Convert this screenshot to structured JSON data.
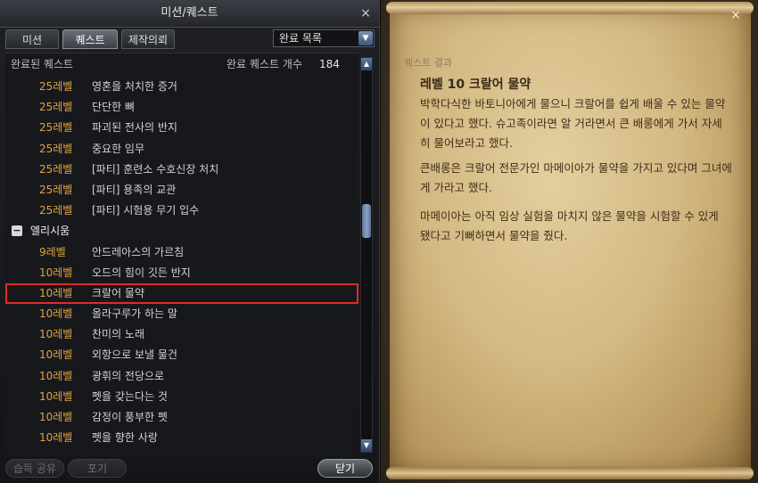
{
  "window": {
    "title": "미션/퀘스트",
    "close_glyph": "×"
  },
  "tabs": [
    {
      "label": "미션",
      "active": false
    },
    {
      "label": "퀘스트",
      "active": true
    },
    {
      "label": "제작의뢰",
      "active": false
    }
  ],
  "filter": {
    "selected": "완료 목록",
    "arrow_glyph": "▼"
  },
  "list_header": {
    "left": "완료된 퀘스트",
    "count_label": "완료 퀘스트 개수",
    "count": "184"
  },
  "rows": [
    {
      "type": "quest",
      "level": "25레벨",
      "name": "영혼을 처치한 증거"
    },
    {
      "type": "quest",
      "level": "25레벨",
      "name": "단단한 뼈"
    },
    {
      "type": "quest",
      "level": "25레벨",
      "name": "파괴된 전사의 반지"
    },
    {
      "type": "quest",
      "level": "25레벨",
      "name": "중요한 임무"
    },
    {
      "type": "quest",
      "level": "25레벨",
      "name": "[파티] 훈련소 수호신장 처치"
    },
    {
      "type": "quest",
      "level": "25레벨",
      "name": "[파티] 용족의 교관"
    },
    {
      "type": "quest",
      "level": "25레벨",
      "name": "[파티] 시험용 무기 입수"
    },
    {
      "type": "group",
      "toggle": "−",
      "name": "엘리시움"
    },
    {
      "type": "quest",
      "level": "9레벨",
      "name": "안드레아스의 가르침"
    },
    {
      "type": "quest",
      "level": "10레벨",
      "name": "오드의 힘이 깃든 반지"
    },
    {
      "type": "quest",
      "level": "10레벨",
      "name": "크랄어 물약",
      "selected": true
    },
    {
      "type": "quest",
      "level": "10레벨",
      "name": "올라구루가 하는 말"
    },
    {
      "type": "quest",
      "level": "10레벨",
      "name": "찬미의 노래"
    },
    {
      "type": "quest",
      "level": "10레벨",
      "name": "외항으로 보낼 물건"
    },
    {
      "type": "quest",
      "level": "10레벨",
      "name": "광휘의 전당으로"
    },
    {
      "type": "quest",
      "level": "10레벨",
      "name": "펫을 갖는다는 것"
    },
    {
      "type": "quest",
      "level": "10레벨",
      "name": "감정이 풍부한 펫"
    },
    {
      "type": "quest",
      "level": "10레벨",
      "name": "펫을 향한 사랑"
    }
  ],
  "scrollbar": {
    "up_glyph": "▲",
    "down_glyph": "▼"
  },
  "bottom": {
    "share_label": "습득 공유",
    "abandon_label": "포기",
    "close_label": "닫기"
  },
  "result": {
    "section_label": "퀘스트 결과",
    "title": "레벨 10 크랄어 물약",
    "paragraphs": [
      "박학다식한 바토니아에게 물으니 크랄어를 쉽게 배울 수 있는 물약이 있다고 했다. 슈고족이라면 알 거라면서 큰 배롱에게 가서 자세히 물어보라고 했다.",
      "큰배롱은 크랄어 전문가인 마메이아가 물약을 가지고 있다며 그녀에게 가라고 했다.",
      "마메이아는 아직 임상 실험을 마치지 않은 물약을 시험할 수 있게 됐다고 기뻐하면서 물약을 줬다."
    ]
  },
  "colors": {
    "level_text": "#e0a442",
    "selection_outline": "#e02a2a",
    "parchment": "#d3b983",
    "parchment_text": "#3e2d18"
  },
  "icons": [
    "close-icon",
    "chevron-down-icon",
    "collapse-minus-icon",
    "scroll-up-icon",
    "scroll-down-icon"
  ]
}
